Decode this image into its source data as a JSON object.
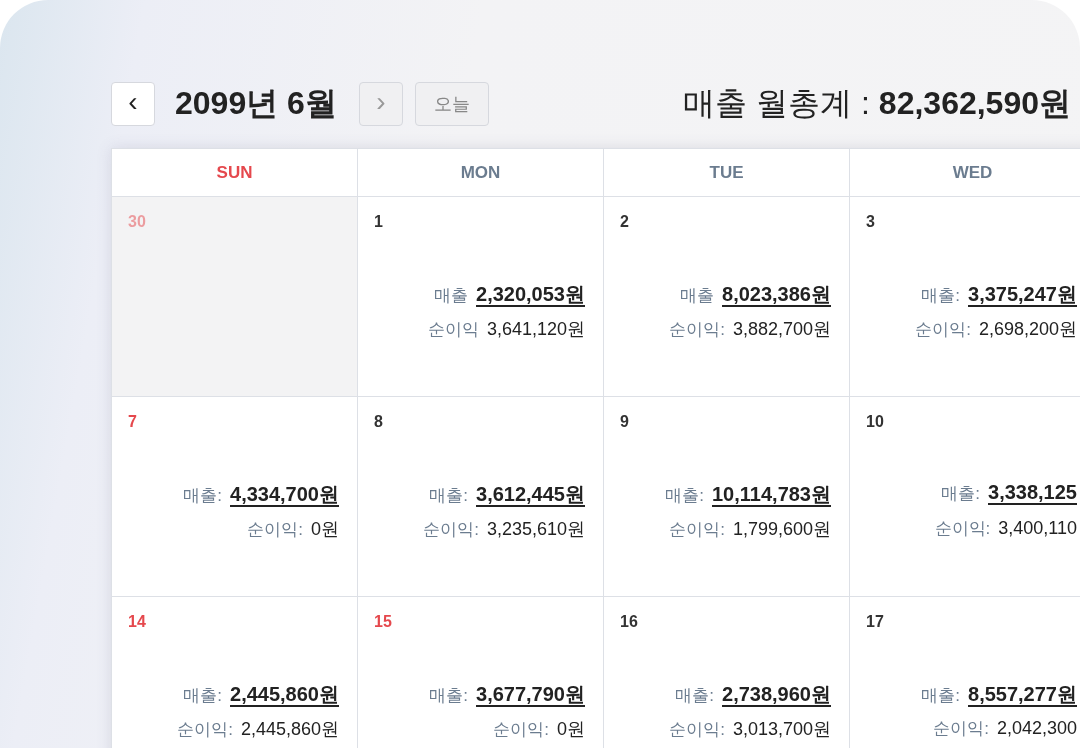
{
  "header": {
    "prev": "‹",
    "title": "2099년 6월",
    "next": "›",
    "next_disabled": true,
    "today": "오늘",
    "monthly_total": "매출 월총계 : **82,362,590원**"
  },
  "weekdays": [
    {
      "label": "SUN",
      "holiday": true
    },
    {
      "label": "MON",
      "holiday": false
    },
    {
      "label": "TUE",
      "holiday": false
    },
    {
      "label": "WED",
      "holiday": false
    }
  ],
  "weeks": [
    [
      {
        "day": "30",
        "holiday": true,
        "other_month": true
      },
      {
        "day": "1",
        "holiday": false,
        "other_month": false,
        "sales_label": "매출",
        "sales": "2,320,053원",
        "profit_label": "순이익",
        "profit": "3,641,120원"
      },
      {
        "day": "2",
        "holiday": false,
        "other_month": false,
        "sales_label": "매출",
        "sales": "8,023,386원",
        "profit_label": "순이익:",
        "profit": "3,882,700원"
      },
      {
        "day": "3",
        "holiday": false,
        "other_month": false,
        "sales_label": "매출:",
        "sales": "3,375,247원",
        "profit_label": "순이익:",
        "profit": "2,698,200원"
      }
    ],
    [
      {
        "day": "7",
        "holiday": true,
        "other_month": false,
        "sales_label": "매출:",
        "sales": "4,334,700원",
        "profit_label": "순이익:",
        "profit": "0원"
      },
      {
        "day": "8",
        "holiday": false,
        "other_month": false,
        "sales_label": "매출:",
        "sales": "3,612,445원",
        "profit_label": "순이익:",
        "profit": "3,235,610원"
      },
      {
        "day": "9",
        "holiday": false,
        "other_month": false,
        "sales_label": "매출:",
        "sales": "10,114,783원",
        "profit_label": "순이익:",
        "profit": "1,799,600원"
      },
      {
        "day": "10",
        "holiday": false,
        "other_month": false,
        "sales_label": "매출:",
        "sales": "3,338,125",
        "profit_label": "순이익:",
        "profit": "3,400,110"
      }
    ],
    [
      {
        "day": "14",
        "holiday": true,
        "other_month": false,
        "sales_label": "매출:",
        "sales": "2,445,860원",
        "profit_label": "순이익:",
        "profit": "2,445,860원"
      },
      {
        "day": "15",
        "holiday": true,
        "other_month": false,
        "sales_label": "매출:",
        "sales": "3,677,790원",
        "profit_label": "순이익:",
        "profit": "0원"
      },
      {
        "day": "16",
        "holiday": false,
        "other_month": false,
        "sales_label": "매출:",
        "sales": "2,738,960원",
        "profit_label": "순이익:",
        "profit": "3,013,700원"
      },
      {
        "day": "17",
        "holiday": false,
        "other_month": false,
        "sales_label": "매출:",
        "sales": "8,557,277원",
        "profit_label": "순이익:",
        "profit": "2,042,300"
      }
    ]
  ]
}
